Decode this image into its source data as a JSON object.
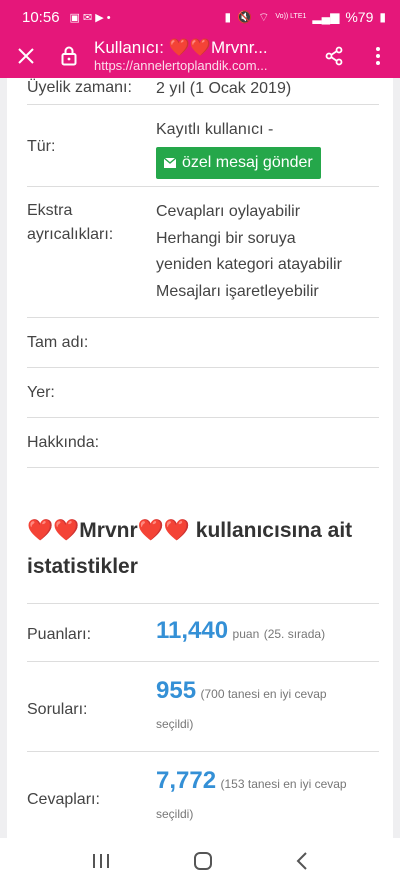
{
  "status_bar": {
    "time": "10:56",
    "network": "Vo)) LTE1",
    "battery": "%79"
  },
  "toolbar": {
    "title": "Kullanıcı: ❤️❤️Mrvnr...",
    "url": "https://annelertoplandik.com..."
  },
  "profile": {
    "partial_label": "Üyelik zamanı:",
    "partial_value": "2 yıl (1 Ocak 2019)",
    "type_label": "Tür:",
    "type_value": "Kayıtlı kullanıcı -",
    "pm_button": "özel mesaj gönder",
    "extra_label_1": "Ekstra",
    "extra_label_2": "ayrıcalıkları:",
    "extra_values": [
      "Cevapları oylayabilir",
      "Herhangi bir soruya",
      "yeniden kategori atayabilir",
      "Mesajları işaretleyebilir"
    ],
    "fullname_label": "Tam adı:",
    "location_label": "Yer:",
    "about_label": "Hakkında:"
  },
  "stats": {
    "title_hearts_pre": "❤️❤️",
    "title_name": "Mrvnr",
    "title_hearts_post": "❤️❤️",
    "title_suffix": " kullanıcısına ait",
    "title_line2": "istatistikler",
    "points_label": "Puanları:",
    "points_value": "11,440",
    "points_unit": "puan",
    "points_rank": "(25. sırada)",
    "questions_label": "Soruları:",
    "questions_value": "955",
    "questions_note_1": "(700 tanesi en iyi cevap",
    "questions_note_2": "seçildi)",
    "answers_label": "Cevapları:",
    "answers_value": "7,772",
    "answers_note_1": "(153 tanesi en iyi cevap",
    "answers_note_2": "seçildi)"
  },
  "colors": {
    "brand": "#e5177a",
    "pm_button": "#25a74a",
    "stat_number": "#3490d6"
  }
}
